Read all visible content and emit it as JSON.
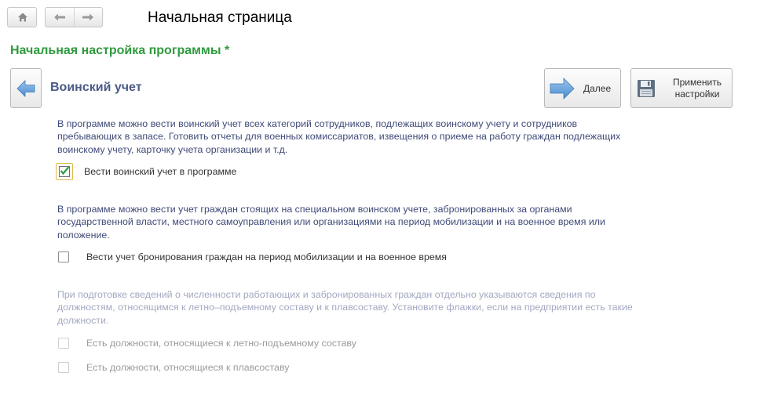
{
  "nav": {
    "home_icon": "home-icon",
    "back_icon": "arrow-left-icon",
    "forward_icon": "arrow-right-icon"
  },
  "page_title": "Начальная страница",
  "section_title": "Начальная настройка программы *",
  "toolbar": {
    "next_label": "Далее",
    "apply_label_line1": "Применить",
    "apply_label_line2": "настройки"
  },
  "step_title": "Воинский учет",
  "paragraphs": {
    "p1": "В программе можно вести воинский учет всех категорий сотрудников, подлежащих воинскому учету и сотрудников пребывающих в запасе. Готовить отчеты для военных комиссариатов, извещения о приеме на работу граждан подлежащих воинскому учету, карточку учета организации и т.д.",
    "p2": "В программе можно вести учет граждан стоящих на специальном воинском учете, забронированных за органами государственной власти, местного самоуправления или организациями на период мобилизации и на военное время или положение.",
    "p3": "При подготовке сведений о численности работающих и забронированных граждан отдельно указываются сведения по должностям, относящимся к летно–подъемному составу и к плавсоставу. Установите флажки, если на предприятии есть такие должности."
  },
  "checkboxes": {
    "military_accounting": {
      "label": "Вести воинский учет в программе",
      "checked": true
    },
    "reservation": {
      "label": "Вести учет бронирования граждан на период мобилизации и на военное время",
      "checked": false
    },
    "flight_crew": {
      "label": "Есть должности, относящиеся к летно-подъемному составу",
      "checked": false
    },
    "sailing_crew": {
      "label": "Есть должности, относящиеся к плавсоставу",
      "checked": false
    }
  },
  "colors": {
    "section_title": "#2f9a3e",
    "step_title": "#4a5b86",
    "paragraph_text": "#3f4a78",
    "disabled_text": "#a3a8c1",
    "arrow_blue": "#5b9bd5",
    "focus_border": "#e0b94a"
  }
}
